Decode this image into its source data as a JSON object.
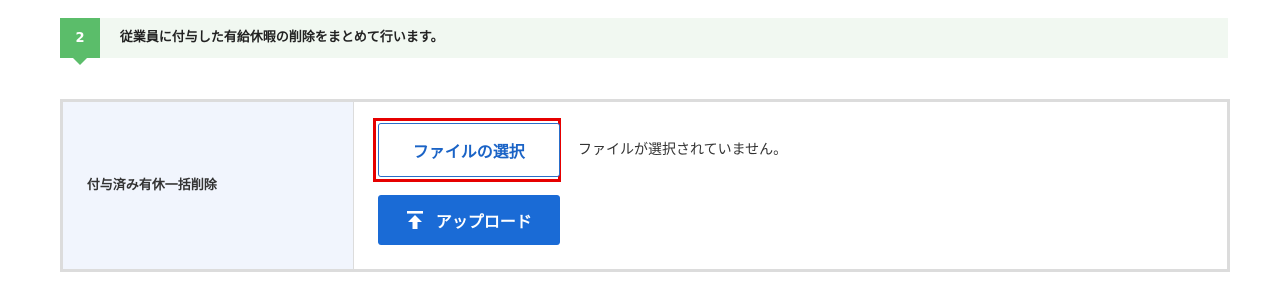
{
  "step": {
    "number": "2",
    "text": "従業員に付与した有給休暇の削除をまとめて行います。"
  },
  "form": {
    "label": "付与済み有休一括削除",
    "file_button_label": "ファイルの選択",
    "file_status": "ファイルが選択されていません。",
    "upload_button_label": "アップロード",
    "upload_icon": "upload-arrow-icon"
  },
  "colors": {
    "step_badge": "#5bbd6a",
    "step_bar_bg": "#f1f8f1",
    "label_cell_bg": "#f1f5fd",
    "primary_blue": "#1a6bd6",
    "highlight_red": "#e60000",
    "table_border": "#dcdcdc"
  }
}
